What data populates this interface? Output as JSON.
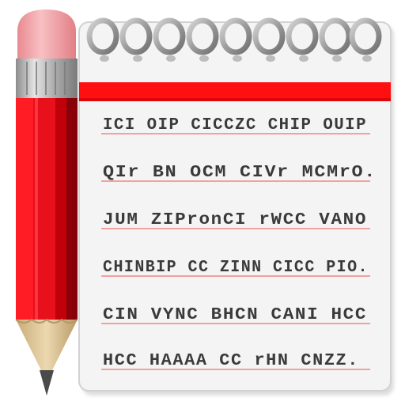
{
  "icon": {
    "name": "notepad-pencil-icon",
    "colors": {
      "pencil_red": "#e8101a",
      "pencil_dark": "#8a0008",
      "eraser_pink": "#f3a2a6",
      "ferrule_gray": "#b8b8b8",
      "wood_tan": "#e0c89a",
      "lead_gray": "#4a4a4a",
      "paper": "#f4f4f4",
      "header_red": "#ff1010",
      "rule_pink": "#f2a0a0",
      "ring_gray": "#a8a8a8"
    }
  },
  "notepad": {
    "lines": [
      "ICI OIP CICCZC CHIP OUIP",
      "QIr BN OCM CIVr MCMrO.",
      "JUM ZIPronCI rWCC VANO",
      "CHINBIP CC ZINN CICC PIO.",
      "CIN VYNC BHCN CANI HCC",
      "HCC HAAAA CC rHN CNZZ."
    ]
  }
}
